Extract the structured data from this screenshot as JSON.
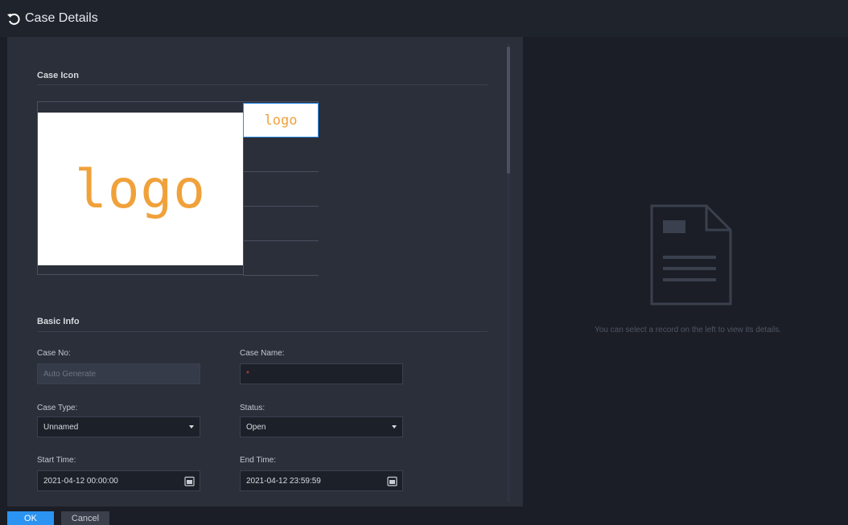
{
  "header": {
    "title": "Case Details",
    "back_icon": "undo-arrow-icon"
  },
  "case_icon": {
    "section_title": "Case Icon",
    "preview_text": "logo",
    "thumbnails": [
      {
        "text": "logo",
        "selected": true
      },
      {
        "text": "",
        "selected": false
      },
      {
        "text": "",
        "selected": false
      },
      {
        "text": "",
        "selected": false
      },
      {
        "text": "",
        "selected": false
      }
    ],
    "logo_color": "#f0a13a"
  },
  "basic_info": {
    "section_title": "Basic Info",
    "case_no": {
      "label": "Case No:",
      "placeholder": "Auto Generate"
    },
    "case_name": {
      "label": "Case Name:",
      "value": "",
      "required_mark": "*"
    },
    "case_type": {
      "label": "Case Type:",
      "value": "Unnamed"
    },
    "status": {
      "label": "Status:",
      "value": "Open"
    },
    "start_time": {
      "label": "Start Time:",
      "value": "2021-04-12 00:00:00"
    },
    "end_time": {
      "label": "End Time:",
      "value": "2021-04-12 23:59:59"
    }
  },
  "footer": {
    "ok_label": "OK",
    "cancel_label": "Cancel",
    "accent": "#2b93f1"
  },
  "detail_panel": {
    "empty_message": "You can select a record on the left to view its details.",
    "icon": "document-icon"
  }
}
